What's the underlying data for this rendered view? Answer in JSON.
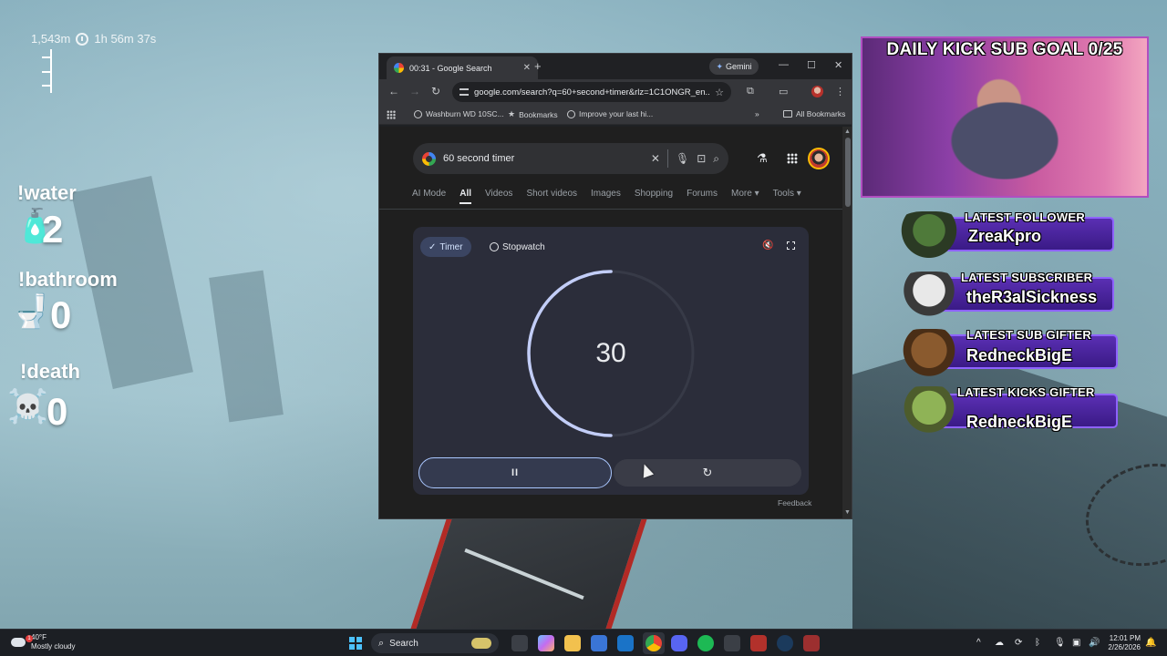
{
  "hud": {
    "altitude": "1,543m",
    "elapsed": "1h 56m 37s"
  },
  "counters": [
    {
      "label": "!water",
      "value": "2",
      "icon": "water-bottle-icon"
    },
    {
      "label": "!bathroom",
      "value": "0",
      "icon": "toilet-icon"
    },
    {
      "label": "!death",
      "value": "0",
      "icon": "skull-crossbones-icon"
    }
  ],
  "browser": {
    "tab_title": "00:31 - Google Search",
    "gemini_label": "Gemini",
    "url": "google.com/search?q=60+second+timer&rlz=1C1ONGR_en...",
    "bookmarks": [
      "Washburn WD 10SC...",
      "Bookmarks",
      "Improve your last hi..."
    ],
    "all_bookmarks": "All Bookmarks"
  },
  "search": {
    "query": "60 second timer",
    "tabs": [
      "AI Mode",
      "All",
      "Videos",
      "Short videos",
      "Images",
      "Shopping",
      "Forums",
      "More",
      "Tools"
    ],
    "active_tab": "All"
  },
  "timer_widget": {
    "mode_timer": "Timer",
    "mode_stopwatch": "Stopwatch",
    "remaining_display": "30",
    "remaining_fraction": 0.5,
    "pause_symbol": "II",
    "reset_symbol": "↻",
    "feedback": "Feedback",
    "accent": "#c2cdf7"
  },
  "overlay": {
    "sub_goal": "DAILY KICK SUB GOAL 0/25",
    "events": [
      {
        "heading": "LATEST FOLLOWER",
        "name": "ZreaKpro"
      },
      {
        "heading": "LATEST SUBSCRIBER",
        "name": "theR3alSickness"
      },
      {
        "heading": "LATEST SUB GIFTER",
        "name": "RedneckBigE"
      },
      {
        "heading": "LATEST KICKS GIFTER",
        "name": "RedneckBigE"
      }
    ]
  },
  "taskbar": {
    "weather_temp": "40°F",
    "weather_desc": "Mostly cloudy",
    "weather_badge": "1",
    "search_label": "Search",
    "time": "12:01 PM",
    "date": "2/26/2026"
  }
}
